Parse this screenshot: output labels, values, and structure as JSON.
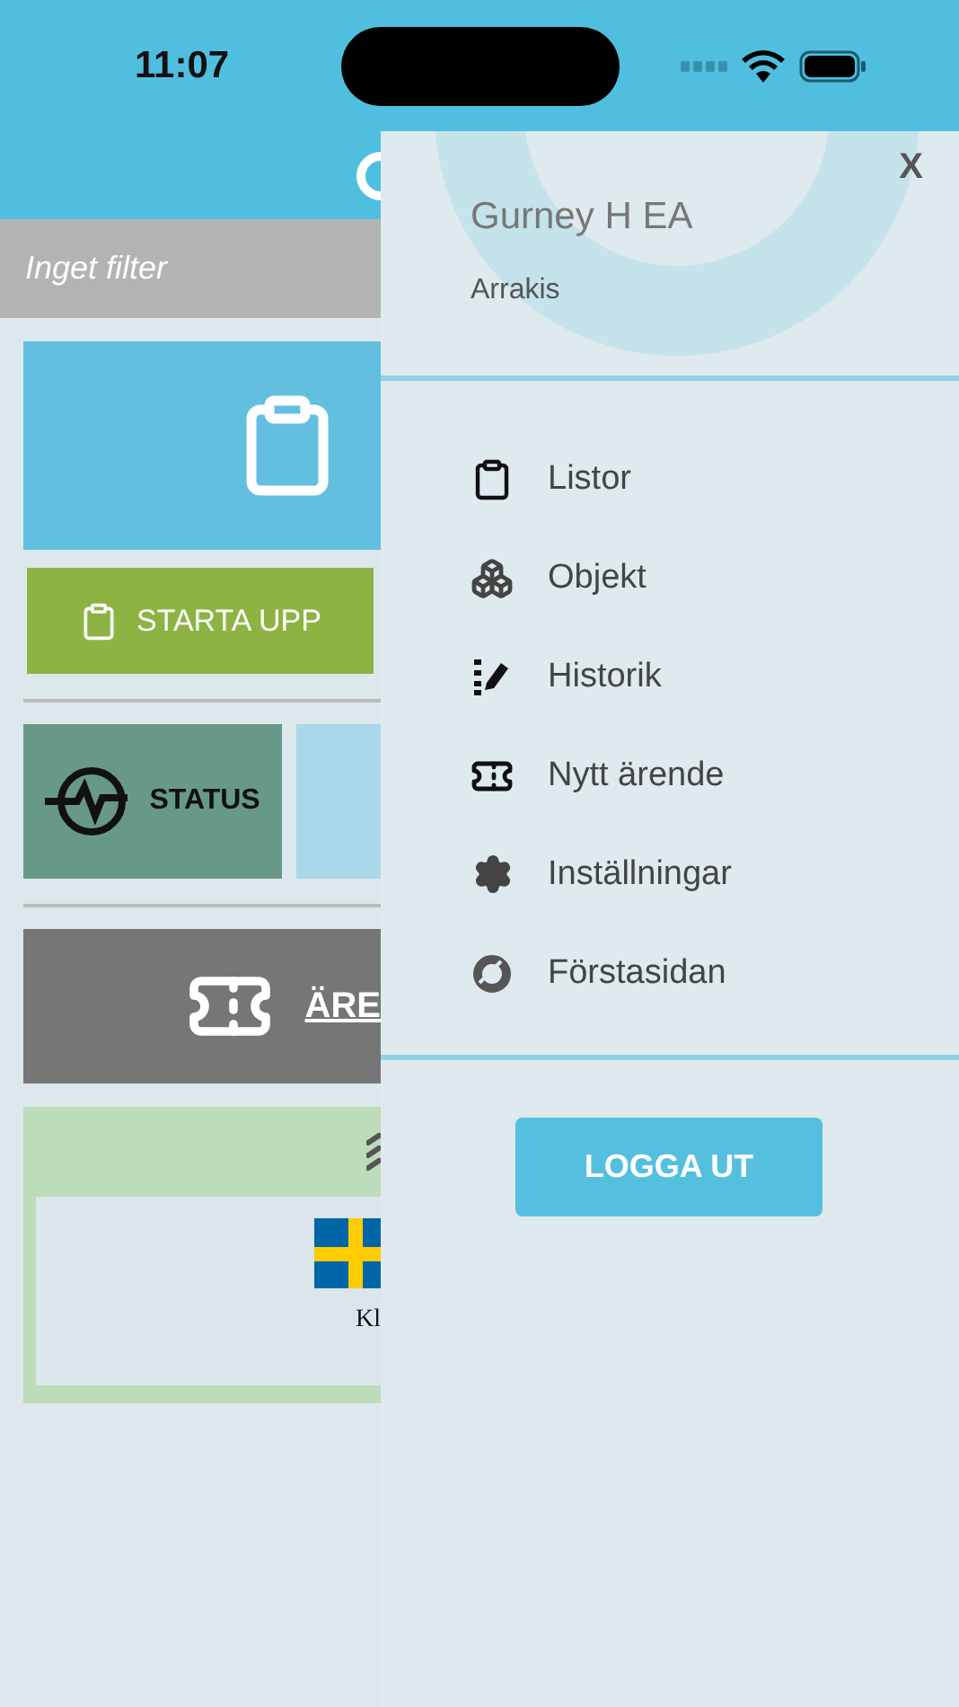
{
  "status_bar": {
    "time": "11:07"
  },
  "filter": {
    "label": "Inget filter"
  },
  "tiles": {
    "start_button": "STARTA UPP",
    "status": "STATUS",
    "issue": "ÄRE",
    "language": "Kl"
  },
  "drawer": {
    "close": "X",
    "user": "Gurney H EA",
    "location": "Arrakis",
    "menu": [
      {
        "label": "Listor",
        "kind": "clipboard"
      },
      {
        "label": "Objekt",
        "kind": "cubes"
      },
      {
        "label": "Historik",
        "kind": "history"
      },
      {
        "label": "Nytt ärende",
        "kind": "ticket"
      },
      {
        "label": "Inställningar",
        "kind": "gear"
      },
      {
        "label": "Förstasidan",
        "kind": "home"
      }
    ],
    "logout": "LOGGA UT"
  }
}
